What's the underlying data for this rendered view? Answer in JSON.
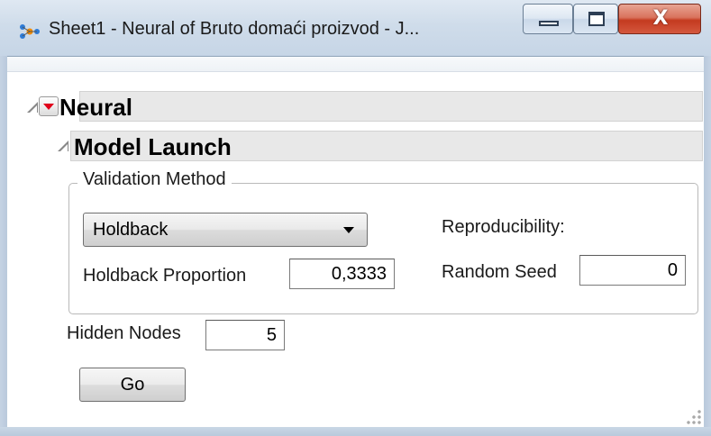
{
  "window": {
    "title": "Sheet1 - Neural of Bruto domaći proizvod - J...",
    "app_icon": "jmp-neural-icon",
    "controls": {
      "minimize": "minimize-icon",
      "maximize": "maximize-icon",
      "close_glyph": "X"
    }
  },
  "neural_section": {
    "title": "Neural",
    "menu_icon": "red-triangle-menu-icon"
  },
  "model_launch": {
    "title": "Model Launch",
    "validation_method": {
      "legend": "Validation Method",
      "method_selected": "Holdback",
      "holdback_proportion_label": "Holdback Proportion",
      "holdback_proportion_value": "0,3333",
      "reproducibility_label": "Reproducibility:",
      "random_seed_label": "Random Seed",
      "random_seed_value": "0"
    },
    "hidden_nodes_label": "Hidden Nodes",
    "hidden_nodes_value": "5",
    "go_label": "Go"
  },
  "colors": {
    "red_triangle": "#e0001a",
    "section_bar": "#e8e8e8",
    "close_button": "#c43a1f"
  }
}
